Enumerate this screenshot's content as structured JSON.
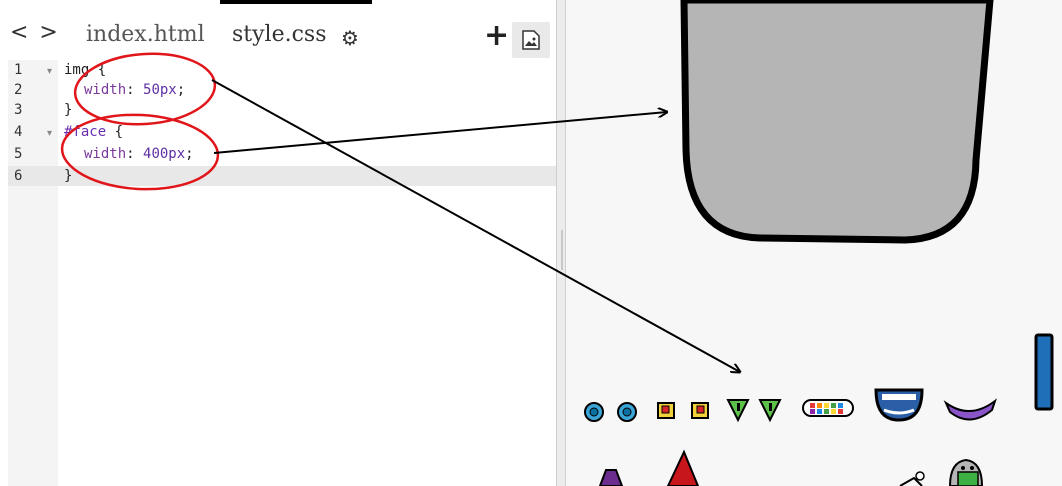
{
  "nav": {
    "back_forward": "< >"
  },
  "tabs": [
    {
      "label": "index.html"
    },
    {
      "label": "style.css"
    }
  ],
  "toolbar": {
    "add_label": "+"
  },
  "code": {
    "line_numbers": [
      "1",
      "2",
      "3",
      "4",
      "5",
      "6"
    ],
    "lines": [
      {
        "selector": "img",
        "brace": " {"
      },
      {
        "property": "width",
        "colon": ": ",
        "value": "50px",
        "end": ";"
      },
      {
        "text": "}"
      },
      {
        "selector": "#face",
        "brace": " {"
      },
      {
        "property": "width",
        "colon": ": ",
        "value": "400px",
        "end": ";"
      },
      {
        "text": "}"
      }
    ]
  },
  "colors": {
    "annotation_red": "#e0161b",
    "face_gray": "#b5b5b5",
    "highlight_line": "#e8e8e8"
  }
}
